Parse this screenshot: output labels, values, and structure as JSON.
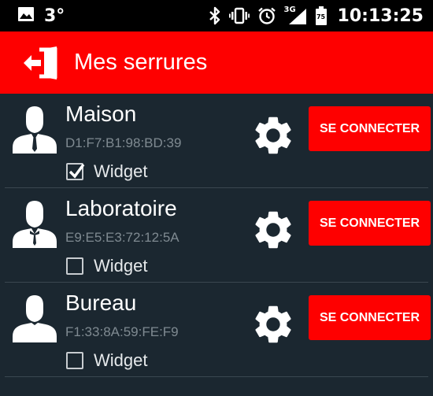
{
  "status_bar": {
    "temperature": "3°",
    "network_type": "3G",
    "battery_level": "75",
    "time": "10:13:25",
    "icons": [
      "image-icon",
      "bluetooth-icon",
      "vibrate-icon",
      "alarm-icon",
      "signal-icon",
      "battery-icon"
    ]
  },
  "app_bar": {
    "title": "Mes serrures",
    "icon": "logout-door-icon",
    "background": "#fe0000"
  },
  "locks": [
    {
      "name": "Maison",
      "mac": "D1:F7:B1:98:BD:39",
      "widget_label": "Widget",
      "widget_checked": true,
      "connect_label": "SE CONNECTER"
    },
    {
      "name": "Laboratoire",
      "mac": "E9:E5:E3:72:12:5A",
      "widget_label": "Widget",
      "widget_checked": false,
      "connect_label": "SE CONNECTER"
    },
    {
      "name": "Bureau",
      "mac": "F1:33:8A:59:FE:F9",
      "widget_label": "Widget",
      "widget_checked": false,
      "connect_label": "SE CONNECTER"
    }
  ],
  "colors": {
    "accent": "#fe0000",
    "background": "#1b2730",
    "mac_text": "#7f8a91"
  }
}
